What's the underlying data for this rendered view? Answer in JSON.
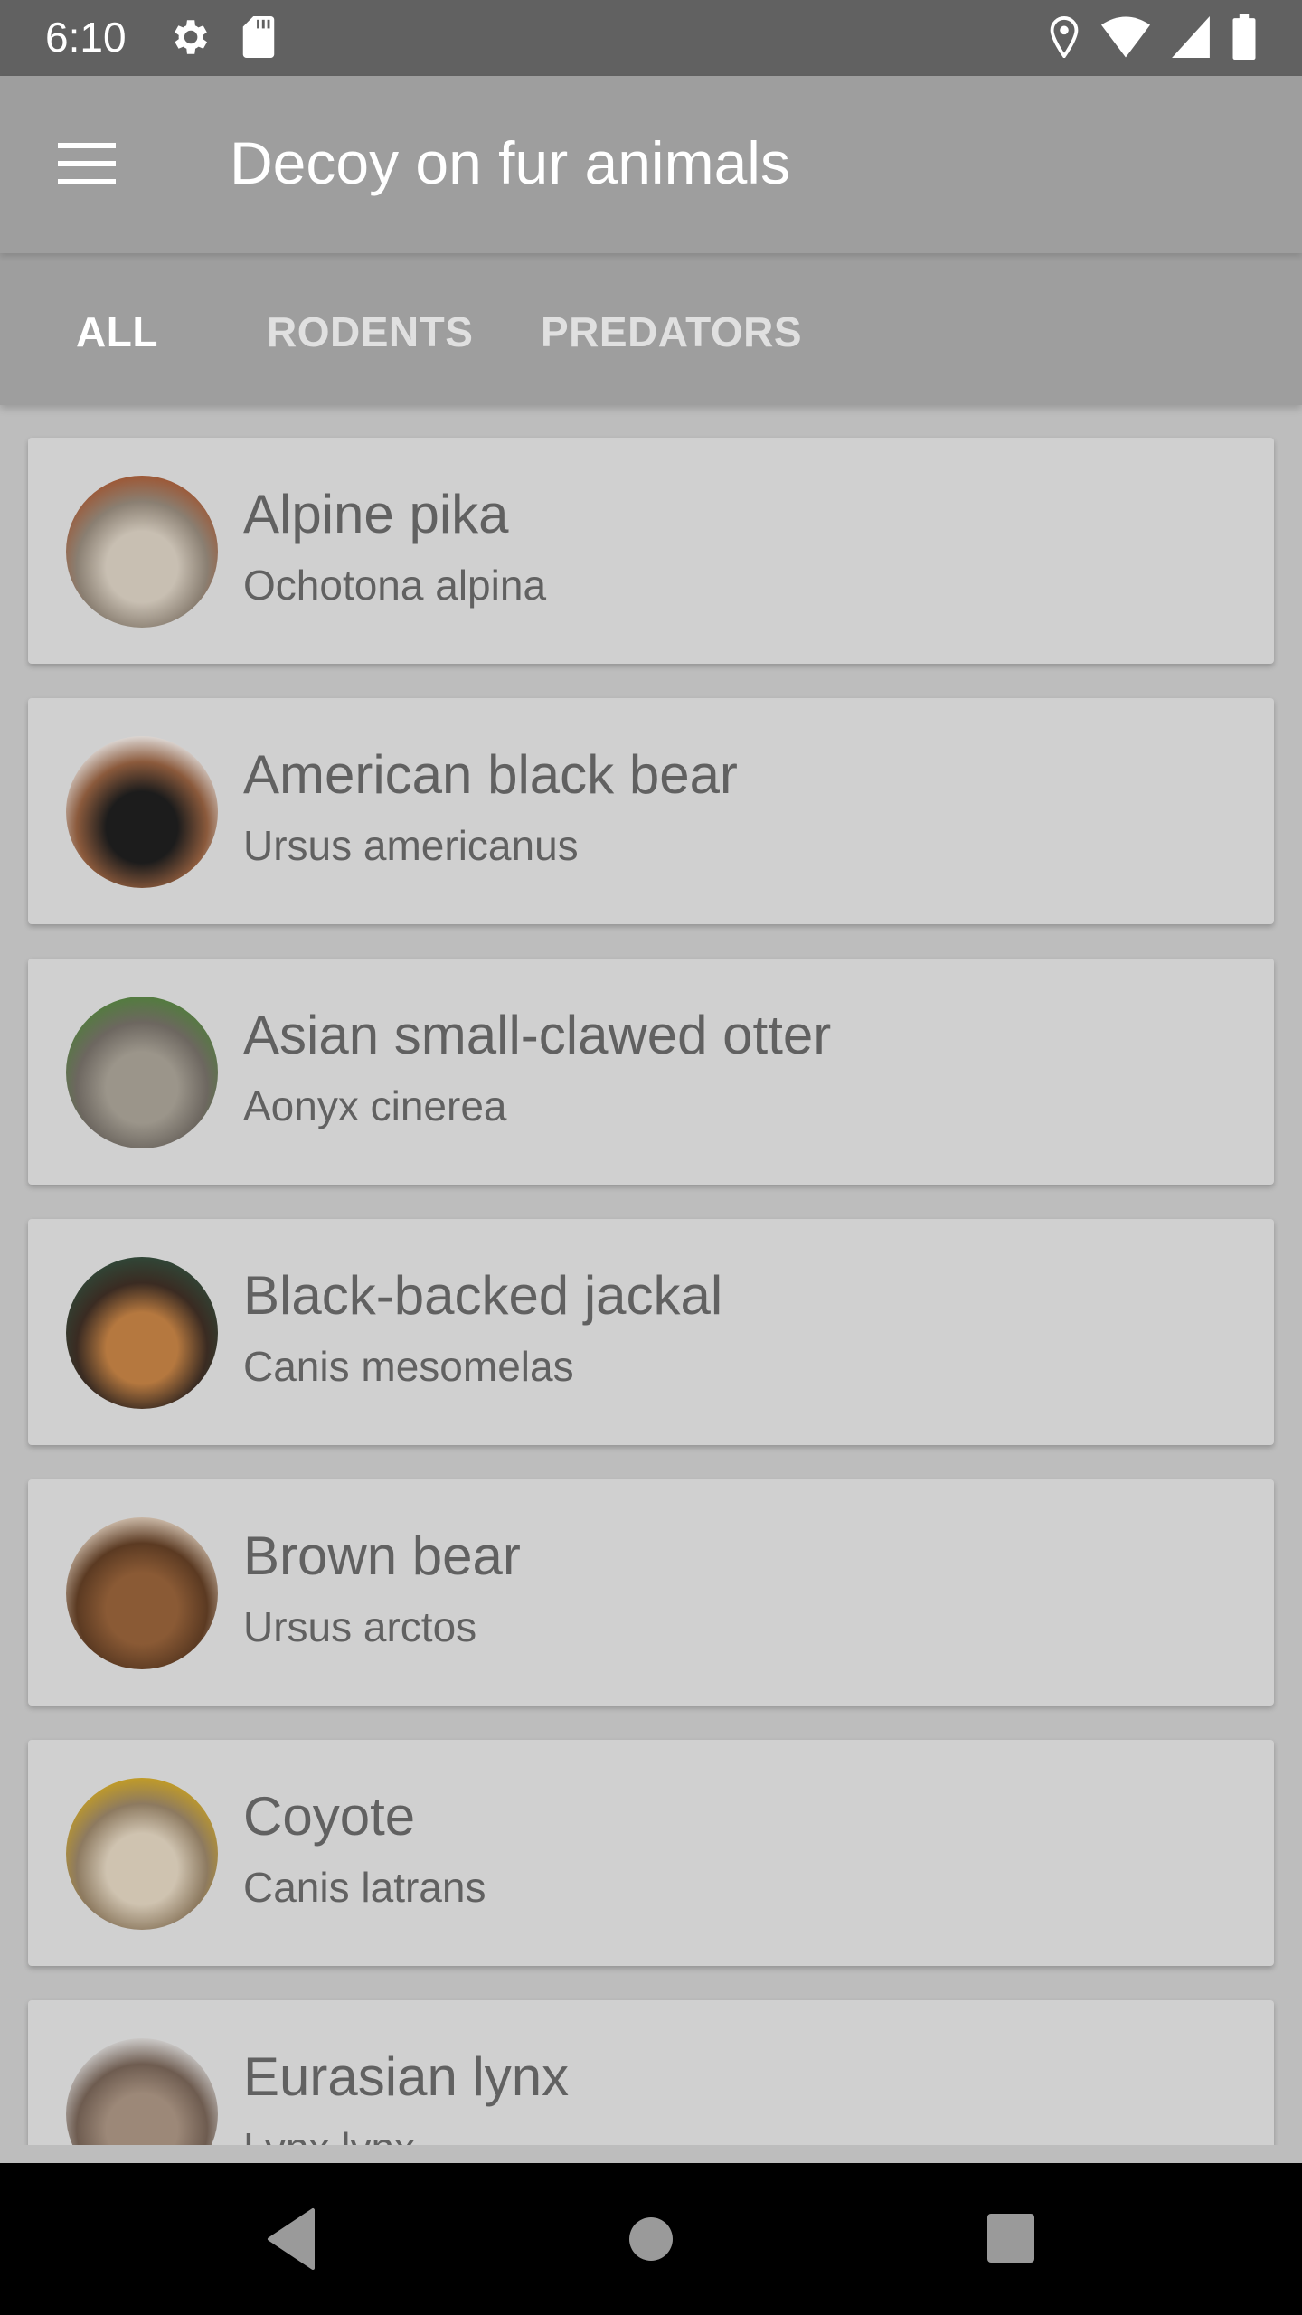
{
  "status_bar": {
    "time": "6:10",
    "left_icons": [
      "gear-icon",
      "sd-card-icon"
    ],
    "right_icons": [
      "location-icon",
      "wifi-icon",
      "signal-icon",
      "battery-icon"
    ]
  },
  "app_bar": {
    "menu_icon": "menu-icon",
    "title": "Decoy on fur animals"
  },
  "tabs": [
    {
      "label": "ALL",
      "active": true
    },
    {
      "label": "RODENTS",
      "active": false
    },
    {
      "label": "PREDATORS",
      "active": false
    }
  ],
  "animals": [
    {
      "name": "Alpine pika",
      "latin": "Ochotona alpina",
      "photo_colors": [
        "#a0522d",
        "#c8bfb2",
        "#8a7f72"
      ]
    },
    {
      "name": "American black bear",
      "latin": "Ursus americanus",
      "photo_colors": [
        "#e8e8e8",
        "#1c1c1c",
        "#8b5a3c"
      ]
    },
    {
      "name": "Asian small-clawed otter",
      "latin": "Aonyx cinerea",
      "photo_colors": [
        "#4f7f3a",
        "#9b958a",
        "#6d6760"
      ]
    },
    {
      "name": "Black-backed jackal",
      "latin": "Canis mesomelas",
      "photo_colors": [
        "#2f4a3a",
        "#b5783f",
        "#3a2b22"
      ]
    },
    {
      "name": "Brown bear",
      "latin": "Ursus arctos",
      "photo_colors": [
        "#d9c9b8",
        "#8a5a35",
        "#5b3a22"
      ]
    },
    {
      "name": "Coyote",
      "latin": "Canis latrans",
      "photo_colors": [
        "#c8a020",
        "#cfc3b0",
        "#8d7a60"
      ]
    },
    {
      "name": "Eurasian lynx",
      "latin": "Lynx lynx",
      "photo_colors": [
        "#d8d8d8",
        "#9c8878",
        "#6e5c50"
      ]
    }
  ],
  "nav_bar": {
    "back": "back-icon",
    "home": "home-icon",
    "recents": "recents-icon"
  }
}
